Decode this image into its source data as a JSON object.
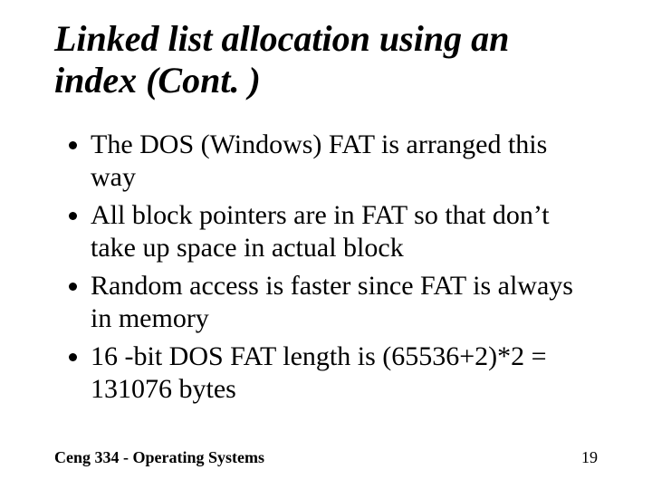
{
  "title": "Linked list allocation using an index (Cont. )",
  "bullets": [
    "The DOS (Windows) FAT is arranged this way",
    "All block pointers are in FAT so that don’t take up space in actual block",
    "Random access is faster since FAT is always in memory",
    "16 -bit DOS FAT length is (65536+2)*2 = 131076 bytes"
  ],
  "footer": {
    "course": "Ceng 334 - Operating Systems",
    "page": "19"
  }
}
